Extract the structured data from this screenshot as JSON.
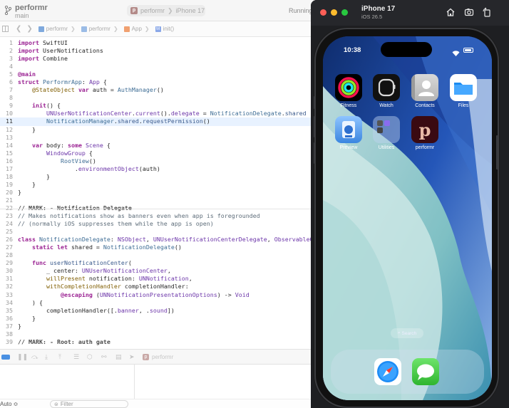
{
  "toolbar": {
    "project_name": "performr",
    "branch": "main",
    "scheme_app": "performr",
    "scheme_device": "iPhone 17",
    "run_status": "Running"
  },
  "jumpbar": {
    "crumbs": [
      "performr",
      "performr",
      "App",
      "init()"
    ]
  },
  "editor": {
    "current_line": 11,
    "lines": [
      {
        "n": "1"
      },
      {
        "n": "2"
      },
      {
        "n": "3"
      },
      {
        "n": "4"
      },
      {
        "n": "5"
      },
      {
        "n": "6"
      },
      {
        "n": "7"
      },
      {
        "n": "8"
      },
      {
        "n": "9"
      },
      {
        "n": "10"
      },
      {
        "n": "11"
      },
      {
        "n": "12"
      },
      {
        "n": "13"
      },
      {
        "n": "14"
      },
      {
        "n": "15"
      },
      {
        "n": "16"
      },
      {
        "n": "17"
      },
      {
        "n": "18"
      },
      {
        "n": "19"
      },
      {
        "n": "20"
      },
      {
        "n": "21"
      },
      {
        "n": "22"
      },
      {
        "n": "23"
      },
      {
        "n": "24"
      },
      {
        "n": "25"
      },
      {
        "n": "26"
      },
      {
        "n": "27"
      },
      {
        "n": "28"
      },
      {
        "n": "29"
      },
      {
        "n": "30"
      },
      {
        "n": "31"
      },
      {
        "n": "32"
      },
      {
        "n": "33"
      },
      {
        "n": "34"
      },
      {
        "n": "35"
      },
      {
        "n": "36"
      },
      {
        "n": "37"
      },
      {
        "n": "38"
      },
      {
        "n": "39"
      }
    ],
    "tokens": {
      "l1": [
        "import",
        " SwiftUI"
      ],
      "l2": [
        "import",
        " UserNotifications"
      ],
      "l3": [
        "import",
        " Combine"
      ],
      "l5": "@main",
      "l6": [
        "struct",
        " ",
        "PerformrApp",
        ": ",
        "App",
        " {"
      ],
      "l7": [
        "    ",
        "@StateObject",
        " ",
        "var",
        " auth = ",
        "AuthManager",
        "()"
      ],
      "l9": [
        "    ",
        "init",
        "() {"
      ],
      "l10": [
        "        ",
        "UNUserNotificationCenter",
        ".",
        "current",
        "().",
        "delegate",
        " = ",
        "NotificationDelegate",
        ".",
        "shared"
      ],
      "l11": [
        "        ",
        "NotificationManager",
        ".",
        "shared",
        ".",
        "requestPermission",
        "()"
      ],
      "l12": "    }",
      "l14": [
        "    ",
        "var",
        " body: ",
        "some",
        " ",
        "Scene",
        " {"
      ],
      "l15": [
        "        ",
        "WindowGroup",
        " {"
      ],
      "l16": [
        "            ",
        "RootView",
        "()"
      ],
      "l17": [
        "                .",
        "environmentObject",
        "(auth)"
      ],
      "l18": "        }",
      "l19": "    }",
      "l20": "}",
      "l22": [
        "// MARK: - Notification Delegate"
      ],
      "l23": "// Makes notifications show as banners even when app is foregrounded",
      "l24": "// (normally iOS suppresses them while the app is open)",
      "l26": [
        "class",
        " ",
        "NotificationDelegate",
        ": ",
        "NSObject",
        ", ",
        "UNUserNotificationCenterDelegate",
        ", ",
        "ObservableObje"
      ],
      "l27": [
        "    ",
        "static",
        " ",
        "let",
        " shared = ",
        "NotificationDelegate",
        "()"
      ],
      "l29": [
        "    ",
        "func",
        " ",
        "userNotificationCenter",
        "("
      ],
      "l30": [
        "        _ center: ",
        "UNUserNotificationCenter",
        ","
      ],
      "l31": [
        "        ",
        "willPresent",
        " notification: ",
        "UNNotification",
        ","
      ],
      "l32": [
        "        ",
        "withCompletionHandler",
        " completionHandler:"
      ],
      "l33": [
        "            ",
        "@escaping",
        " (",
        "UNNotificationPresentationOptions",
        ") -> ",
        "Void"
      ],
      "l34": "    ) {",
      "l35": [
        "        completionHandler([.",
        "banner",
        ", .",
        "sound",
        "])"
      ],
      "l36": "    }",
      "l37": "}",
      "l39": [
        "// MARK: - Root: auth gate"
      ]
    }
  },
  "debugbar": {
    "target": "performr"
  },
  "console": {
    "auto_label": "Auto ≎",
    "filter_placeholder": "Filter"
  },
  "simulator": {
    "device_name": "iPhone 17",
    "os_version": "iOS 26.5",
    "time": "10:38",
    "apps": [
      {
        "label": "Fitness",
        "icon": "fitness-icon"
      },
      {
        "label": "Watch",
        "icon": "watch-icon"
      },
      {
        "label": "Contacts",
        "icon": "contacts-icon"
      },
      {
        "label": "Files",
        "icon": "files-icon"
      },
      {
        "label": "Preview",
        "icon": "preview-icon"
      },
      {
        "label": "Utilities",
        "icon": "utilities-folder-icon"
      },
      {
        "label": "performr",
        "icon": "performr-app-icon"
      }
    ],
    "search_label": "Search",
    "dock": [
      "safari-icon",
      "messages-icon"
    ]
  },
  "colors": {
    "accent": "#3478f6",
    "keyword": "#9b2393",
    "current_line_bg": "#e8f2ff",
    "wallpaper_blue": "#1a3f8a"
  }
}
